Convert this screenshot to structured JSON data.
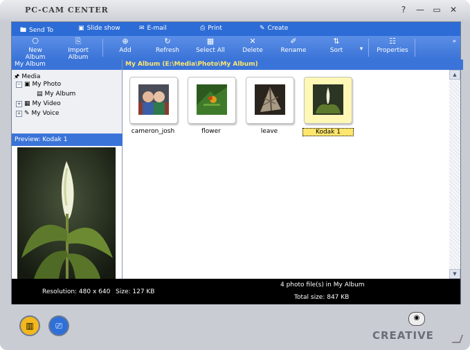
{
  "app": {
    "title": "PC-CAM CENTER"
  },
  "window_buttons": [
    "?",
    "—",
    "▭",
    "✕"
  ],
  "menubar": [
    {
      "label": "Send To",
      "icon": "send-to-icon"
    },
    {
      "label": "Slide show",
      "icon": "slide-show-icon"
    },
    {
      "label": "E-mail",
      "icon": "email-icon"
    },
    {
      "label": "Print",
      "icon": "print-icon"
    },
    {
      "label": "Create",
      "icon": "create-icon"
    }
  ],
  "toolbar": [
    {
      "label": "New Album",
      "icon": "new-album-icon"
    },
    {
      "label": "Import Album",
      "icon": "import-album-icon"
    },
    {
      "label": "Add",
      "icon": "add-icon"
    },
    {
      "label": "Refresh",
      "icon": "refresh-icon"
    },
    {
      "label": "Select All",
      "icon": "select-all-icon"
    },
    {
      "label": "Delete",
      "icon": "delete-icon"
    },
    {
      "label": "Rename",
      "icon": "rename-icon"
    },
    {
      "label": "Sort",
      "icon": "sort-icon"
    },
    {
      "label": "Properties",
      "icon": "properties-icon"
    }
  ],
  "left_pane": {
    "header": "My Album",
    "tree": [
      {
        "label": "Media"
      },
      {
        "label": "My Photo"
      },
      {
        "label": "My Album"
      },
      {
        "label": "My Video"
      },
      {
        "label": "My Voice"
      }
    ],
    "preview_header": "Preview: Kodak 1"
  },
  "main": {
    "header": "My Album    (E:\\Media\\Photo\\My Album)",
    "thumbnails": [
      {
        "label": "cameron_josh"
      },
      {
        "label": "flower"
      },
      {
        "label": "leave"
      },
      {
        "label": "Kodak 1",
        "selected": true
      }
    ]
  },
  "status": {
    "resolution": "Resolution: 480 x 640",
    "size": "Size: 127 KB",
    "files": "4 photo file(s) in My Album",
    "total": "Total size: 847 KB"
  },
  "brand": "CREATIVE"
}
